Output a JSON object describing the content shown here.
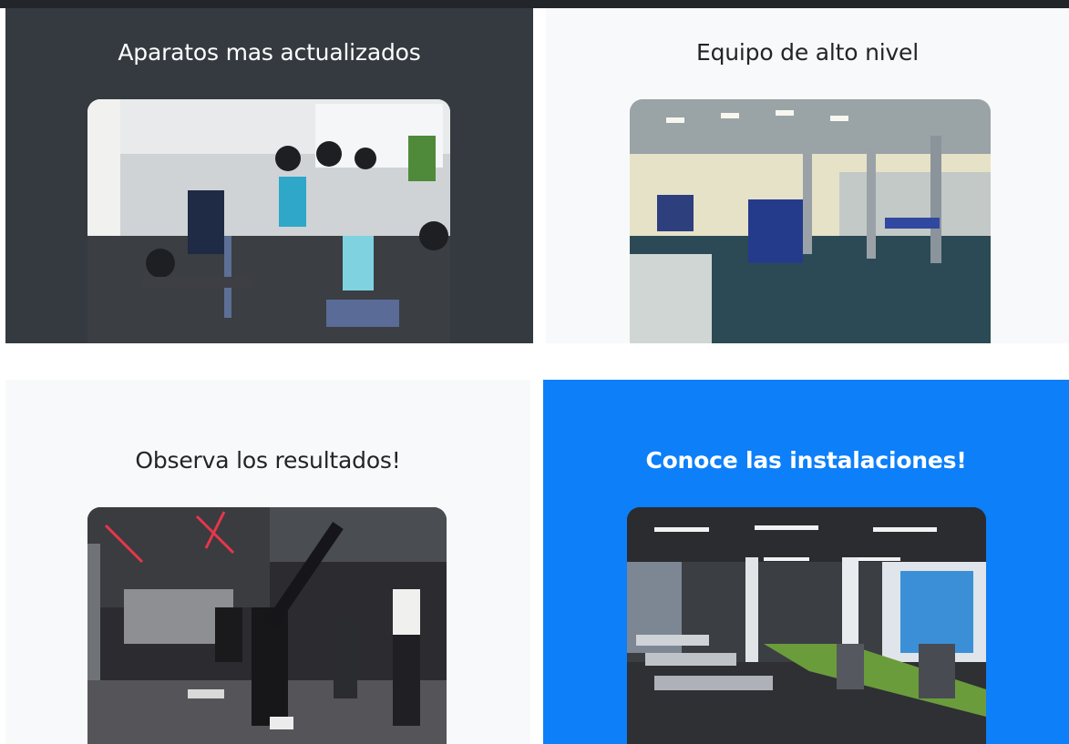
{
  "cards": [
    {
      "title": "Aparatos mas actualizados"
    },
    {
      "title": "Equipo de alto nivel"
    },
    {
      "title": "Observa los resultados!"
    },
    {
      "title": "Conoce las instalaciones!"
    }
  ],
  "colors": {
    "dark_panel": "#343a40",
    "light_panel": "#f8f9fa",
    "primary_panel": "#0d7ff9",
    "top_bar": "#22262b"
  }
}
